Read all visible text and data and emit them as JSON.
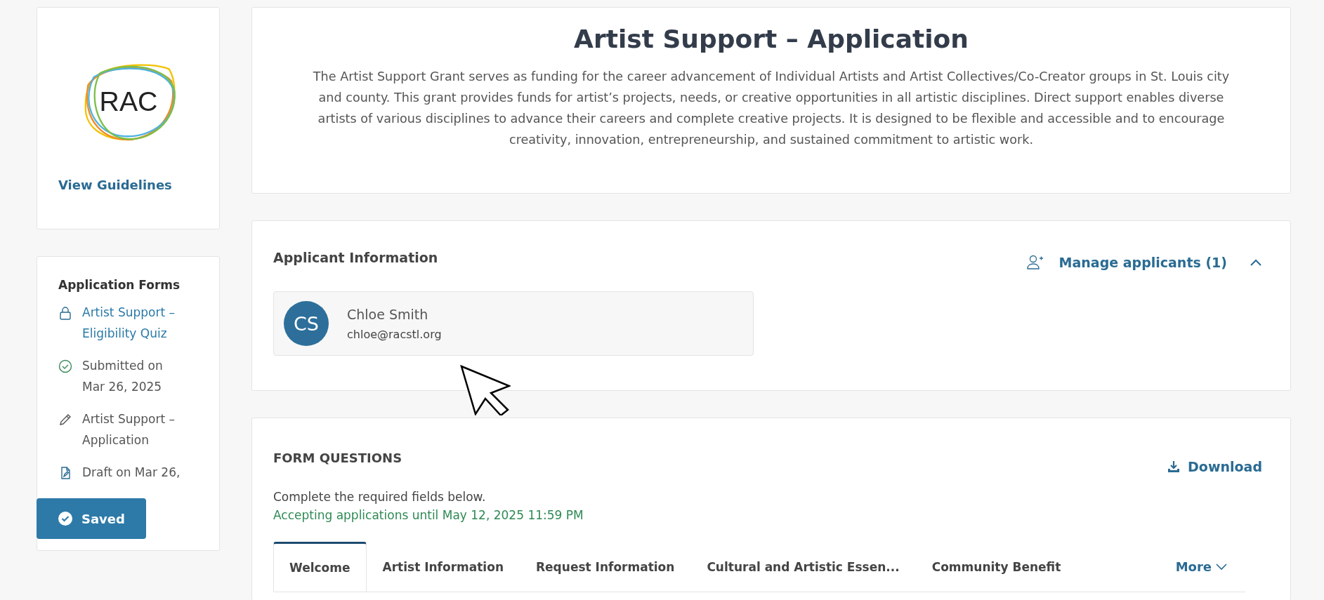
{
  "sidebar": {
    "logo_text": "RAC",
    "guidelines_link": "View Guidelines",
    "forms_title": "Application Forms",
    "forms": [
      {
        "kind": "locked",
        "lines": [
          "Artist Support –",
          "Eligibility Quiz"
        ],
        "link": true
      },
      {
        "kind": "submitted",
        "lines": [
          "Submitted on",
          "Mar 26, 2025"
        ],
        "link": false
      },
      {
        "kind": "edit",
        "lines": [
          "Artist Support –",
          "Application"
        ],
        "link": false
      },
      {
        "kind": "draft",
        "lines": [
          "Draft on Mar 26,"
        ],
        "link": false
      }
    ],
    "saved_button": "Saved"
  },
  "header": {
    "title": "Artist Support – Application",
    "description": "The Artist Support Grant serves as funding for the career advancement of Individual Artists and Artist Collectives/Co-Creator groups in St. Louis city and county. This grant provides funds for artist’s projects, needs, or creative opportunities in all artistic disciplines. Direct support enables diverse artists of various disciplines to advance their careers and complete creative projects. It is designed to be flexible and accessible and to encourage creativity, innovation, entrepreneurship, and sustained commitment to artistic work."
  },
  "applicants": {
    "title": "Applicant Information",
    "manage": "Manage applicants (1)",
    "expanded": true,
    "people": [
      {
        "initials": "CS",
        "name": "Chloe Smith",
        "email": "chloe@racstl.org"
      }
    ]
  },
  "form_questions": {
    "title": "FORM QUESTIONS",
    "download": "Download",
    "instructions": "Complete the required fields below.",
    "deadline": "Accepting applications until May 12, 2025 11:59 PM",
    "tabs": [
      {
        "label": "Welcome",
        "selected": true
      },
      {
        "label": "Artist Information",
        "selected": false
      },
      {
        "label": "Request Information",
        "selected": false
      },
      {
        "label": "Cultural and Artistic Essen...",
        "selected": false
      },
      {
        "label": "Community Benefit",
        "selected": false
      }
    ],
    "more": "More"
  }
}
